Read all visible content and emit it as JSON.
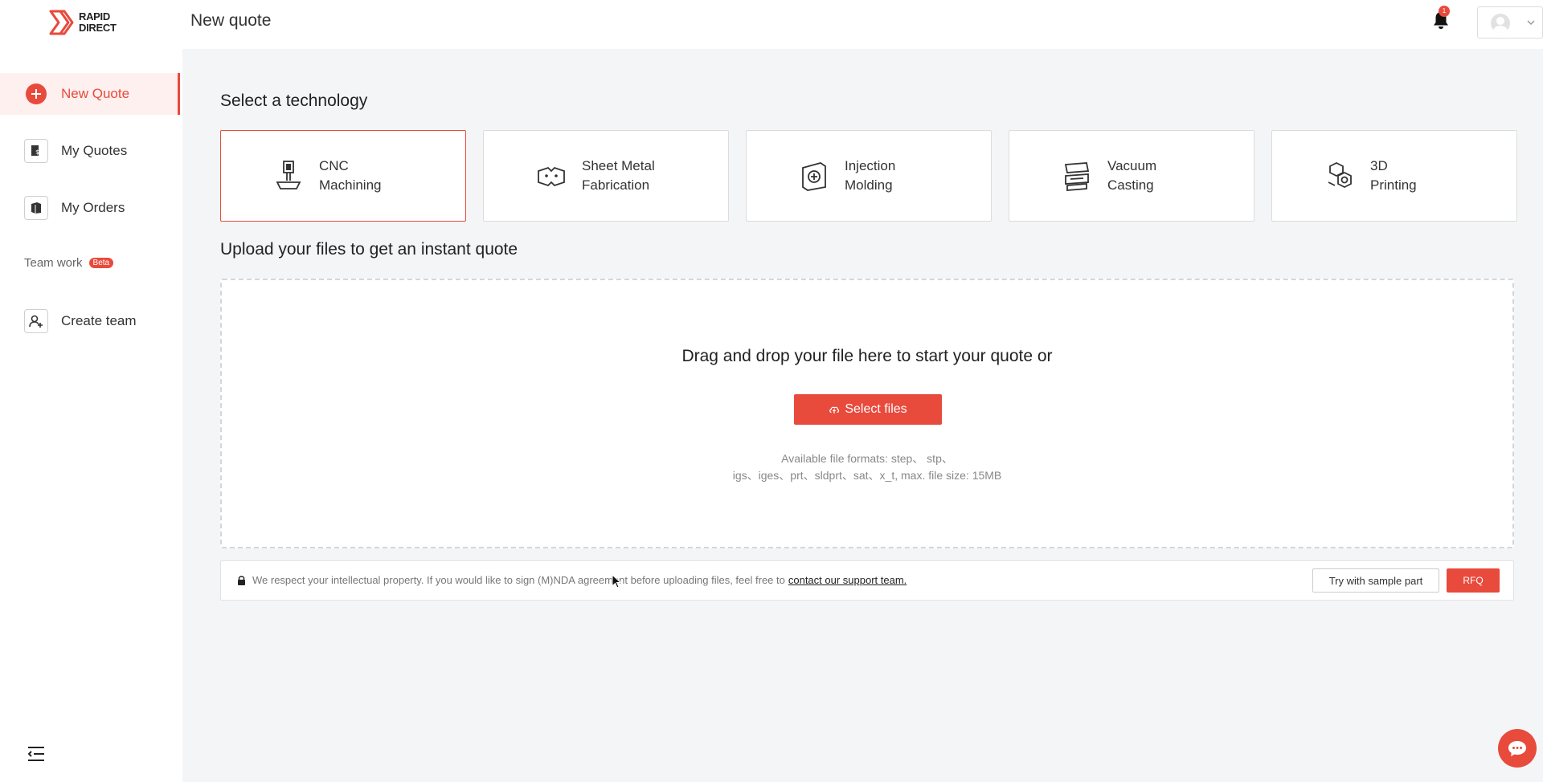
{
  "app": {
    "logo_line1": "RAPID",
    "logo_line2": "DIRECT",
    "page_title": "New quote",
    "notification_count": "1",
    "brand_color": "#e84a3c"
  },
  "sidebar": {
    "items": [
      {
        "label": "New Quote",
        "icon": "plus-circle-icon",
        "active": true
      },
      {
        "label": "My Quotes",
        "icon": "quotes-icon",
        "active": false
      },
      {
        "label": "My Orders",
        "icon": "orders-icon",
        "active": false
      }
    ],
    "section_label": "Team work",
    "section_badge": "Beta",
    "team_item": {
      "label": "Create team",
      "icon": "create-team-icon"
    }
  },
  "main": {
    "tech_heading": "Select a technology",
    "technologies": [
      {
        "label": "CNC\nMachining",
        "icon": "cnc-machining-icon",
        "selected": true
      },
      {
        "label": "Sheet Metal\nFabrication",
        "icon": "sheet-metal-icon",
        "selected": false
      },
      {
        "label": "Injection\nMolding",
        "icon": "injection-molding-icon",
        "selected": false
      },
      {
        "label": "Vacuum\nCasting",
        "icon": "vacuum-casting-icon",
        "selected": false
      },
      {
        "label": "3D\nPrinting",
        "icon": "3d-printing-icon",
        "selected": false
      }
    ],
    "upload_heading": "Upload your files to get an instant quote",
    "dropzone": {
      "title": "Drag and drop your file here to start your quote or",
      "button_label": "Select files",
      "formats_line1": "Available file formats: step、 stp、",
      "formats_line2": "igs、iges、prt、sldprt、sat、x_t, max. file size: 15MB"
    },
    "ip_bar": {
      "text": "We respect your intellectual property. If you would like to sign (M)NDA agreement before uploading files, feel free to",
      "link": "contact our support team.",
      "sample_button": "Try with sample part",
      "rfq_button": "RFQ"
    }
  }
}
